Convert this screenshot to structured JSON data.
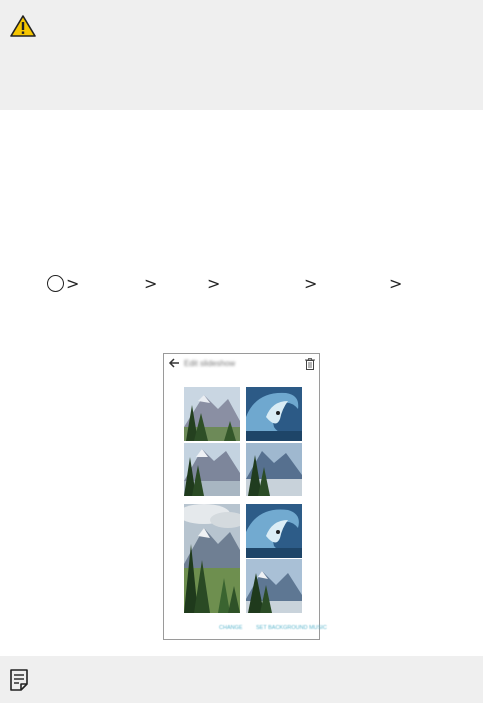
{
  "caution": {
    "icon": "warning-icon",
    "accent": "#f6c600"
  },
  "menu_path": {
    "home_icon": "home-circle-icon",
    "separator": ">"
  },
  "screenshot": {
    "title": "Edit slideshow",
    "footer": {
      "left_button": "CHANGE",
      "right_button": "SET BACKGROUND MUSIC"
    },
    "accent": "#5bb5cc",
    "images": [
      {
        "subject": "mountain-forest"
      },
      {
        "subject": "ocean-wave"
      },
      {
        "subject": "mountain-forest"
      },
      {
        "subject": "mountain-forest"
      },
      {
        "subject": "mountain-forest"
      },
      {
        "subject": "ocean-wave"
      },
      {
        "subject": "mountain-forest"
      }
    ]
  },
  "note": {
    "icon": "note-icon"
  }
}
